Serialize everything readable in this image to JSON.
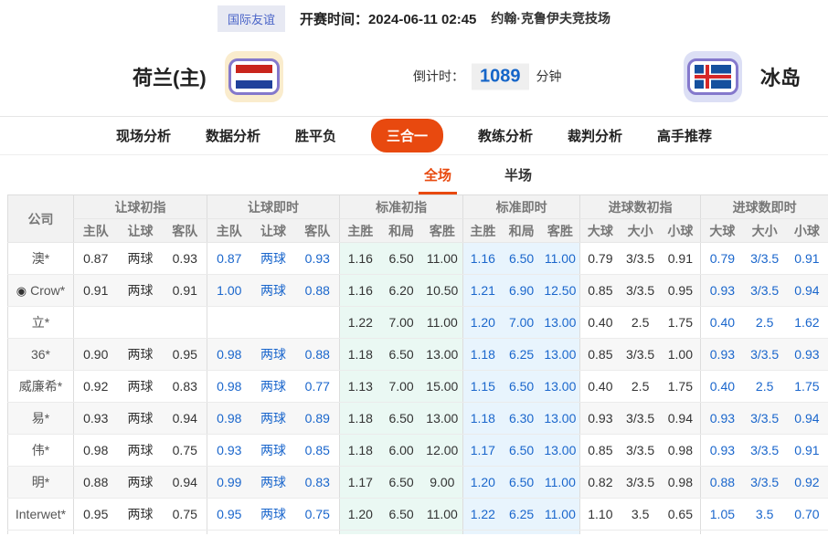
{
  "topbar": {
    "league_badge": "国际友谊",
    "kickoff_label": "开赛时间：2024-06-11 02:45",
    "venue": "约翰·克鲁伊夫竞技场"
  },
  "match": {
    "home_name": "荷兰(主)",
    "away_name": "冰岛",
    "home_flag": "netherlands-flag",
    "away_flag": "iceland-flag",
    "countdown_label": "倒计时：",
    "countdown_value": "1089",
    "countdown_unit": "分钟"
  },
  "nav": {
    "items": [
      {
        "label": "现场分析",
        "active": false
      },
      {
        "label": "数据分析",
        "active": false
      },
      {
        "label": "胜平负",
        "active": false
      },
      {
        "label": "三合一",
        "active": true
      },
      {
        "label": "教练分析",
        "active": false
      },
      {
        "label": "裁判分析",
        "active": false
      },
      {
        "label": "高手推荐",
        "active": false
      }
    ]
  },
  "subtabs": {
    "items": [
      {
        "label": "全场",
        "active": true
      },
      {
        "label": "半场",
        "active": false
      }
    ]
  },
  "icons": {
    "soccer_ball": "◉"
  },
  "colors": {
    "accent_orange": "#e8490f",
    "live_blue": "#1a66cc",
    "countdown_blue": "#1565c8",
    "badge_blue": "#4a64c8",
    "tint_mint": "#eaf8f3",
    "tint_blue": "#e8f4fd"
  },
  "odds_table": {
    "company_header": "公司",
    "groups": [
      {
        "label": "让球初指",
        "cols": [
          "主队",
          "让球",
          "客队"
        ],
        "live": false,
        "tint": null
      },
      {
        "label": "让球即时",
        "cols": [
          "主队",
          "让球",
          "客队"
        ],
        "live": true,
        "tint": null
      },
      {
        "label": "标准初指",
        "cols": [
          "主胜",
          "和局",
          "客胜"
        ],
        "live": false,
        "tint": "mint"
      },
      {
        "label": "标准即时",
        "cols": [
          "主胜",
          "和局",
          "客胜"
        ],
        "live": true,
        "tint": "blue"
      },
      {
        "label": "进球数初指",
        "cols": [
          "大球",
          "大小",
          "小球"
        ],
        "live": false,
        "tint": null
      },
      {
        "label": "进球数即时",
        "cols": [
          "大球",
          "大小",
          "小球"
        ],
        "live": true,
        "tint": null
      }
    ],
    "rows": [
      {
        "company": "澳*",
        "icon": false,
        "odds": [
          [
            "0.87",
            "两球",
            "0.93"
          ],
          [
            "0.87",
            "两球",
            "0.93"
          ],
          [
            "1.16",
            "6.50",
            "11.00"
          ],
          [
            "1.16",
            "6.50",
            "11.00"
          ],
          [
            "0.79",
            "3/3.5",
            "0.91"
          ],
          [
            "0.79",
            "3/3.5",
            "0.91"
          ]
        ]
      },
      {
        "company": "Crow*",
        "icon": true,
        "odds": [
          [
            "0.91",
            "两球",
            "0.91"
          ],
          [
            "1.00",
            "两球",
            "0.88"
          ],
          [
            "1.16",
            "6.20",
            "10.50"
          ],
          [
            "1.21",
            "6.90",
            "12.50"
          ],
          [
            "0.85",
            "3/3.5",
            "0.95"
          ],
          [
            "0.93",
            "3/3.5",
            "0.94"
          ]
        ]
      },
      {
        "company": "立*",
        "icon": false,
        "odds": [
          [
            "",
            "",
            ""
          ],
          [
            "",
            "",
            ""
          ],
          [
            "1.22",
            "7.00",
            "11.00"
          ],
          [
            "1.20",
            "7.00",
            "13.00"
          ],
          [
            "0.40",
            "2.5",
            "1.75"
          ],
          [
            "0.40",
            "2.5",
            "1.62"
          ]
        ]
      },
      {
        "company": "36*",
        "icon": false,
        "odds": [
          [
            "0.90",
            "两球",
            "0.95"
          ],
          [
            "0.98",
            "两球",
            "0.88"
          ],
          [
            "1.18",
            "6.50",
            "13.00"
          ],
          [
            "1.18",
            "6.25",
            "13.00"
          ],
          [
            "0.85",
            "3/3.5",
            "1.00"
          ],
          [
            "0.93",
            "3/3.5",
            "0.93"
          ]
        ]
      },
      {
        "company": "威廉希*",
        "icon": false,
        "odds": [
          [
            "0.92",
            "两球",
            "0.83"
          ],
          [
            "0.98",
            "两球",
            "0.77"
          ],
          [
            "1.13",
            "7.00",
            "15.00"
          ],
          [
            "1.15",
            "6.50",
            "13.00"
          ],
          [
            "0.40",
            "2.5",
            "1.75"
          ],
          [
            "0.40",
            "2.5",
            "1.75"
          ]
        ]
      },
      {
        "company": "易*",
        "icon": false,
        "odds": [
          [
            "0.93",
            "两球",
            "0.94"
          ],
          [
            "0.98",
            "两球",
            "0.89"
          ],
          [
            "1.18",
            "6.50",
            "13.00"
          ],
          [
            "1.18",
            "6.30",
            "13.00"
          ],
          [
            "0.93",
            "3/3.5",
            "0.94"
          ],
          [
            "0.93",
            "3/3.5",
            "0.94"
          ]
        ]
      },
      {
        "company": "伟*",
        "icon": false,
        "odds": [
          [
            "0.98",
            "两球",
            "0.75"
          ],
          [
            "0.93",
            "两球",
            "0.85"
          ],
          [
            "1.18",
            "6.00",
            "12.00"
          ],
          [
            "1.17",
            "6.50",
            "13.00"
          ],
          [
            "0.85",
            "3/3.5",
            "0.98"
          ],
          [
            "0.93",
            "3/3.5",
            "0.91"
          ]
        ]
      },
      {
        "company": "明*",
        "icon": false,
        "odds": [
          [
            "0.88",
            "两球",
            "0.94"
          ],
          [
            "0.99",
            "两球",
            "0.83"
          ],
          [
            "1.17",
            "6.50",
            "9.00"
          ],
          [
            "1.20",
            "6.50",
            "11.00"
          ],
          [
            "0.82",
            "3/3.5",
            "0.98"
          ],
          [
            "0.88",
            "3/3.5",
            "0.92"
          ]
        ]
      },
      {
        "company": "Interwet*",
        "icon": false,
        "odds": [
          [
            "0.95",
            "两球",
            "0.75"
          ],
          [
            "0.95",
            "两球",
            "0.75"
          ],
          [
            "1.20",
            "6.50",
            "11.00"
          ],
          [
            "1.22",
            "6.25",
            "11.00"
          ],
          [
            "1.10",
            "3.5",
            "0.65"
          ],
          [
            "1.05",
            "3.5",
            "0.70"
          ]
        ]
      }
    ]
  }
}
